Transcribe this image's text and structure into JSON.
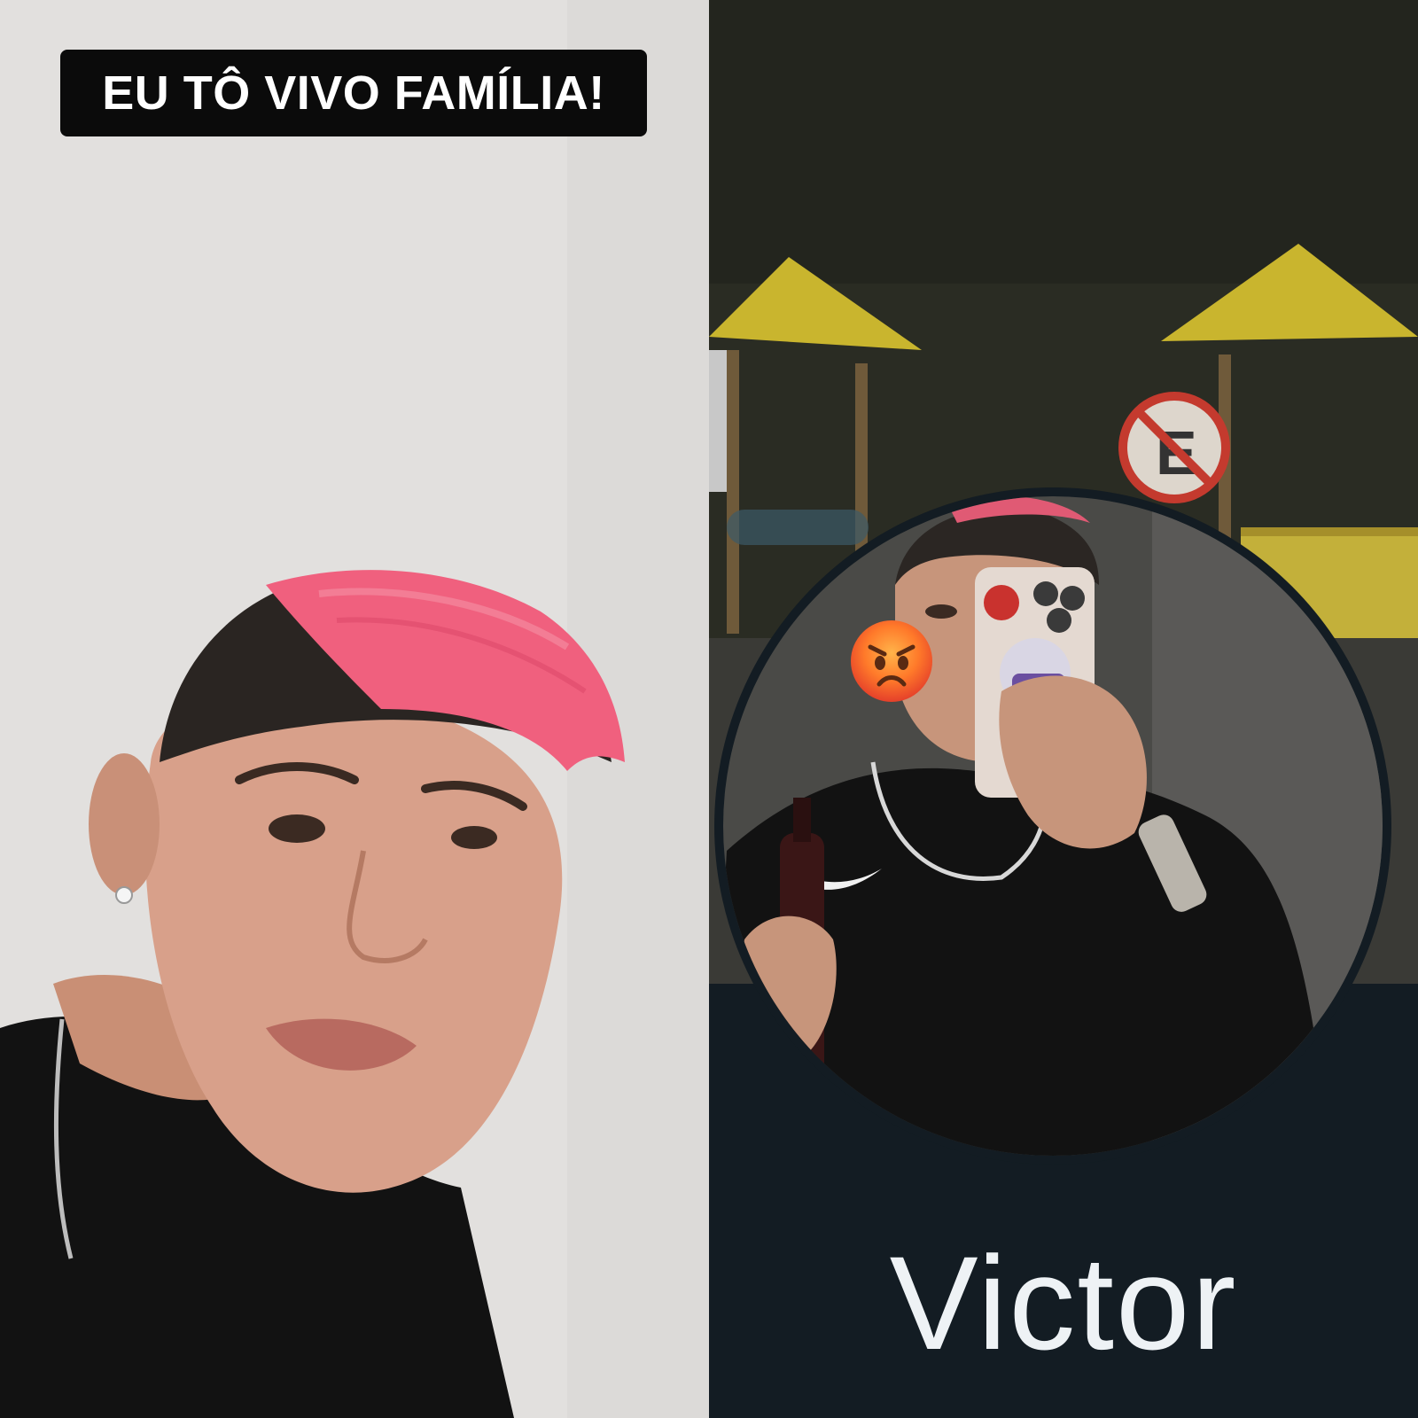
{
  "left_panel": {
    "caption": "EU TÔ VIVO FAMÍLIA!",
    "photo_subject": "selfie-video-frame"
  },
  "right_panel": {
    "profile_name": "Victor",
    "avatar_sticker": "angry-face-emoji",
    "background_color": "#131c23"
  },
  "colors": {
    "hair_pink": "#f0607e",
    "caption_bg": "#0b0b0b",
    "name_text": "#eef2f5",
    "playground_yellow": "#c9b52e"
  }
}
